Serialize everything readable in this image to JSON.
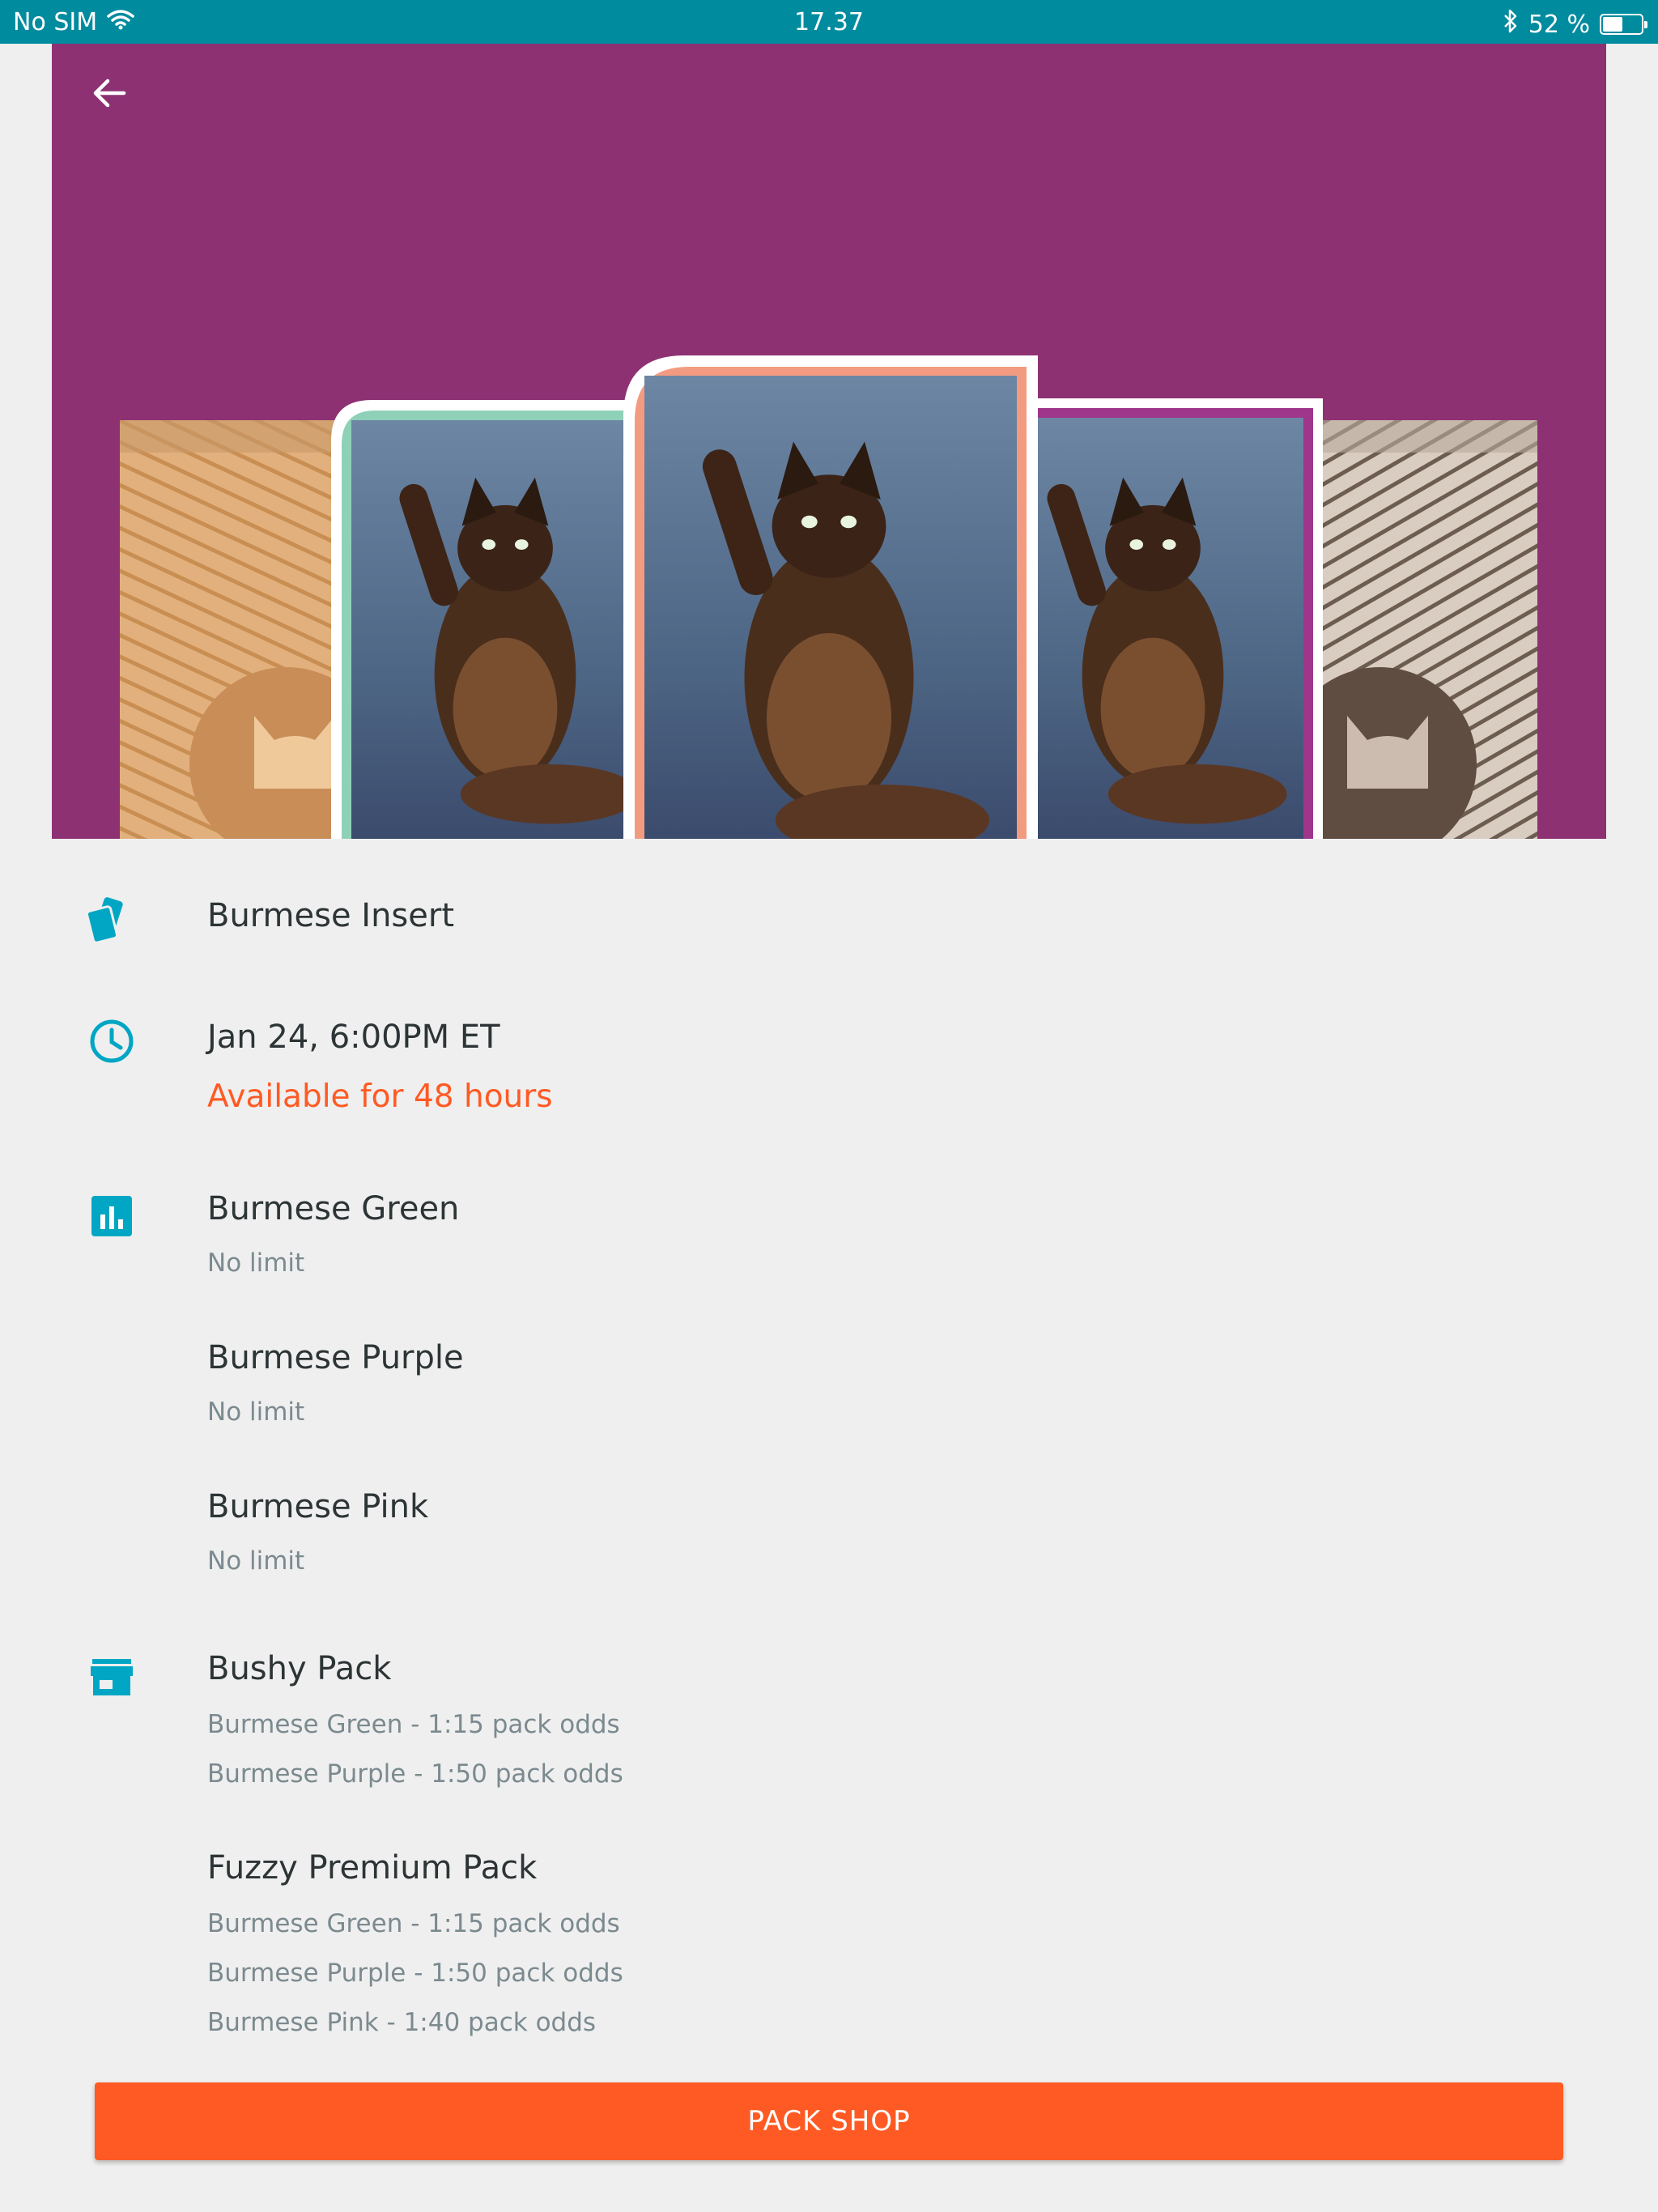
{
  "status_bar": {
    "carrier": "No SIM",
    "time": "17.37",
    "battery": "52 %",
    "battery_level": 0.52
  },
  "colors": {
    "accent": "#ff5a23",
    "teal": "#00a6c4",
    "hero_bg": "#8e3173",
    "status_bar": "#008b9e"
  },
  "insert": {
    "name": "Burmese Insert",
    "icon": "cards-icon"
  },
  "schedule": {
    "date": "Jan 24, 6:00PM ET",
    "availability": "Available for 48 hours",
    "icon": "clock-icon"
  },
  "variants": {
    "icon": "bar-chart-icon",
    "items": [
      {
        "name": "Burmese Green",
        "limit": "No limit"
      },
      {
        "name": "Burmese Purple",
        "limit": "No limit"
      },
      {
        "name": "Burmese Pink",
        "limit": "No limit"
      }
    ]
  },
  "packs": {
    "icon": "store-icon",
    "items": [
      {
        "name": "Bushy Pack",
        "odds": [
          "Burmese Green - 1:15 pack odds",
          "Burmese Purple - 1:50 pack odds"
        ]
      },
      {
        "name": "Fuzzy Premium Pack",
        "odds": [
          "Burmese Green - 1:15 pack odds",
          "Burmese Purple - 1:50 pack odds",
          "Burmese Pink - 1:40 pack odds"
        ]
      }
    ]
  },
  "cta": {
    "label": "PACK SHOP"
  }
}
